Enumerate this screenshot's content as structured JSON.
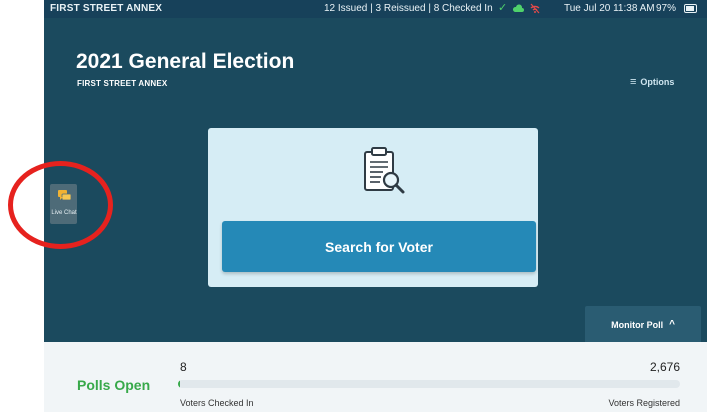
{
  "status_bar": {
    "location": "FIRST STREET ANNEX",
    "counts": "12 Issued | 3 Reissued | 8 Checked In",
    "datetime": "Tue Jul 20  11:38 AM",
    "battery": "97%"
  },
  "header": {
    "title": "2021 General Election",
    "location": "FIRST STREET ANNEX",
    "options_label": "Options",
    "options_icon": "menu-icon"
  },
  "search": {
    "icon": "clipboard-search-icon",
    "button_label": "Search for Voter"
  },
  "live_chat": {
    "label": "Live Chat",
    "icon": "chat-icon"
  },
  "monitor_poll": {
    "label": "Monitor Poll",
    "icon": "chevron-up-icon"
  },
  "stats": {
    "polls_status": "Polls Open",
    "checked_in": "8",
    "checked_in_label": "Voters Checked In",
    "registered": "2,676",
    "registered_label": "Voters Registered",
    "checked_in_fraction": 0.003
  },
  "colors": {
    "background": "#1b4a5e",
    "accent_button": "#2589b7",
    "card": "#d6edf5",
    "status_open": "#38a94a",
    "annotation": "#e6221e"
  }
}
